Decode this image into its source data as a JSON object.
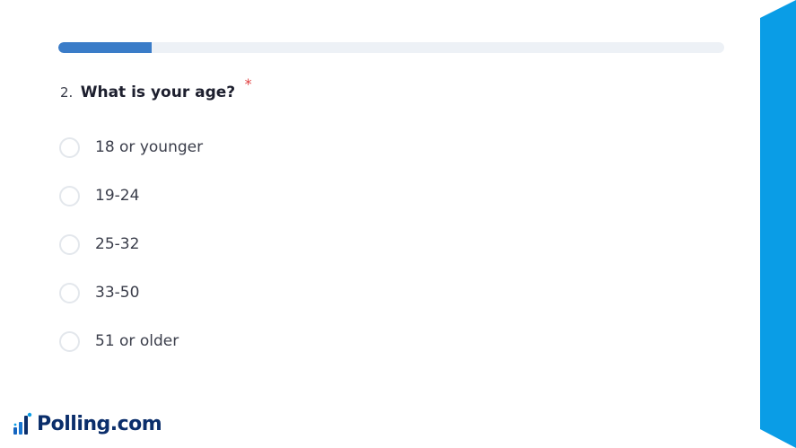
{
  "progress": {
    "fraction": 0.14,
    "color": "#3a7cc8"
  },
  "question": {
    "number": "2.",
    "text": "What is your age?",
    "required_marker": "*"
  },
  "options": [
    "18 or younger",
    "19-24",
    "25-32",
    "33-50",
    "51 or older"
  ],
  "brand": {
    "name": "Polling.com",
    "icon": "bar-chart-icon",
    "color": "#0b2e6b"
  },
  "colors": {
    "accent": "#0a9de6",
    "required": "#e04040"
  }
}
